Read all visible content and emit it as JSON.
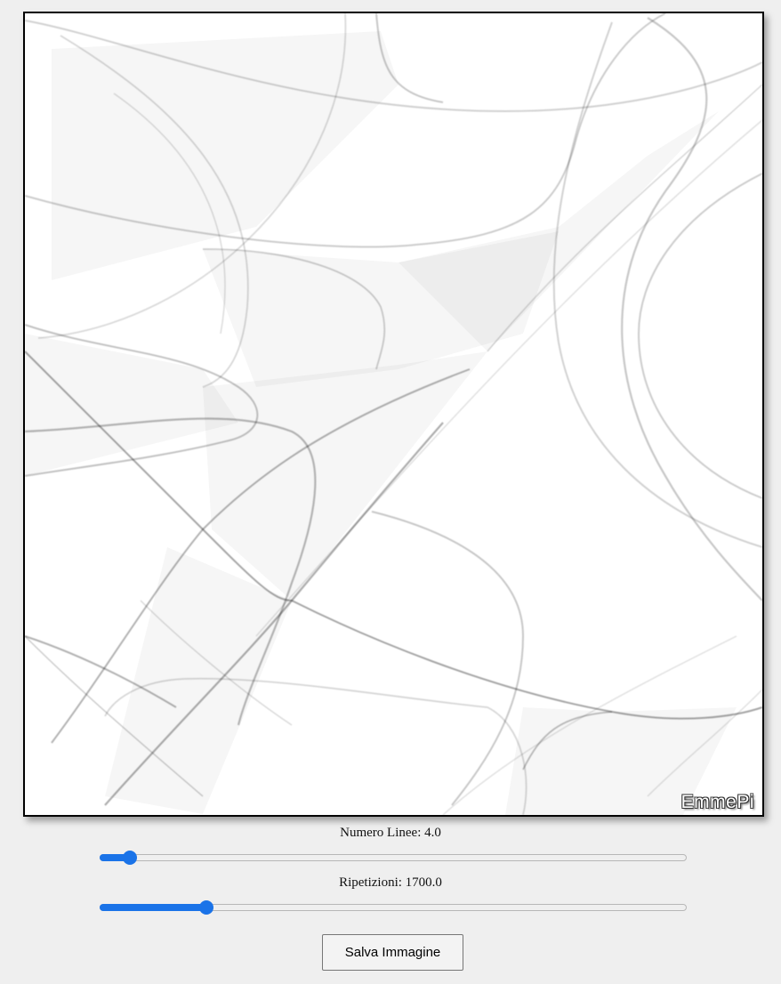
{
  "artwork": {
    "watermark": "EmmePi"
  },
  "controls": {
    "lines": {
      "label": "Numero Linee: 4.0",
      "fraction": 0.04
    },
    "repetitions": {
      "label": "Ripetizioni: 1700.0",
      "fraction": 0.17
    },
    "save_label": "Salva Immagine"
  },
  "colors": {
    "accent": "#1a73e8",
    "page_background": "#efefef",
    "canvas_background": "#ffffff",
    "stroke": "#000000"
  }
}
